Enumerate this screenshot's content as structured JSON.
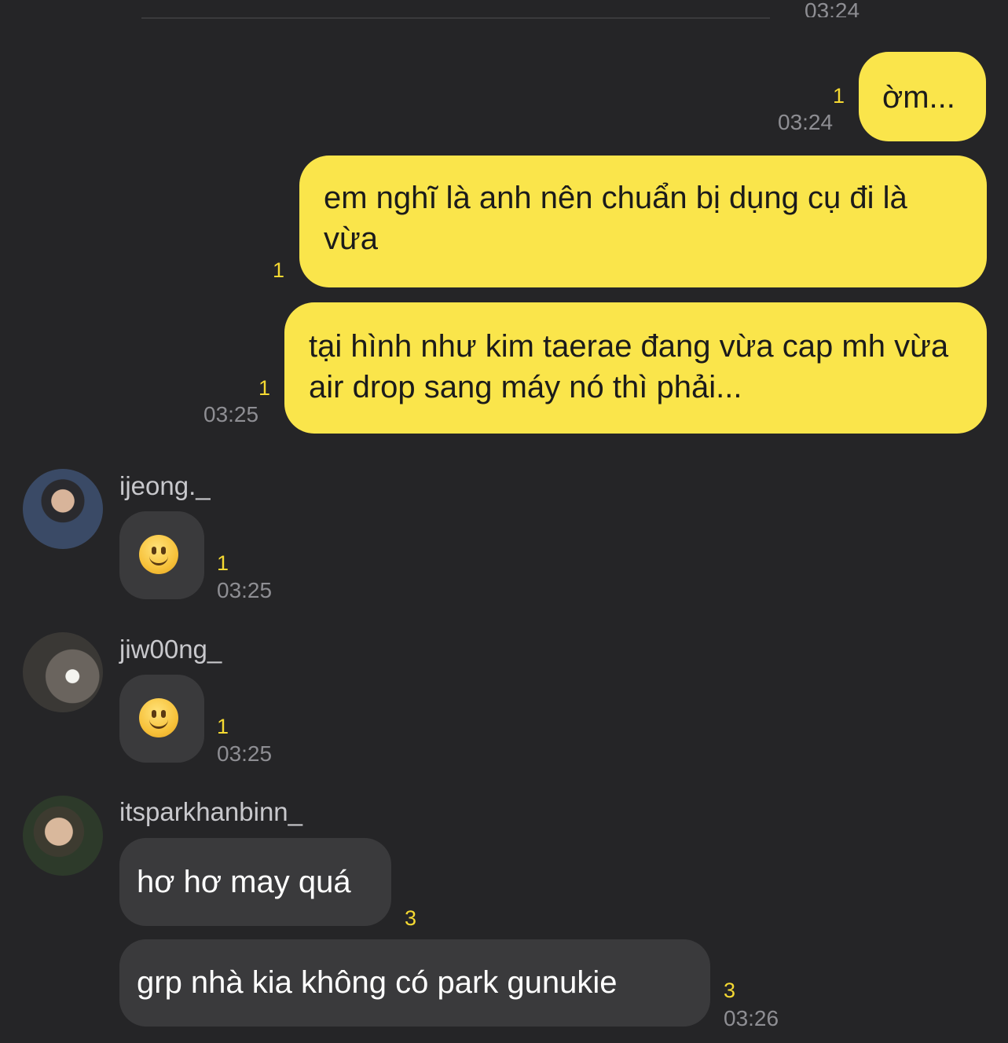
{
  "chat": {
    "top": {
      "time": "03:24"
    },
    "outgoing": [
      {
        "text": "ờm...",
        "unread": "1",
        "time": "03:24"
      },
      {
        "text": "em nghĩ là anh nên chuẩn bị dụng cụ đi là vừa",
        "unread": "1"
      },
      {
        "text": "tại hình như kim taerae đang vừa cap mh vừa air drop sang máy nó thì phải...",
        "unread": "1",
        "time": "03:25"
      }
    ],
    "incoming": [
      {
        "sender": "ijeong._",
        "emoji": "slightly-smiling-face",
        "unread": "1",
        "time": "03:25"
      },
      {
        "sender": "jiw00ng_",
        "emoji": "slightly-smiling-face",
        "unread": "1",
        "time": "03:25"
      },
      {
        "sender": "itsparkhanbinn_",
        "messages": [
          {
            "text": "hơ hơ may quá",
            "unread": "3"
          },
          {
            "text": "grp nhà kia không có park gunukie",
            "unread": "3",
            "time": "03:26"
          }
        ]
      }
    ]
  },
  "colors": {
    "background": "#252527",
    "outgoing_bubble": "#fae54b",
    "incoming_bubble": "#3a3a3c",
    "unread": "#f5d932",
    "timestamp": "#8e8e93"
  }
}
